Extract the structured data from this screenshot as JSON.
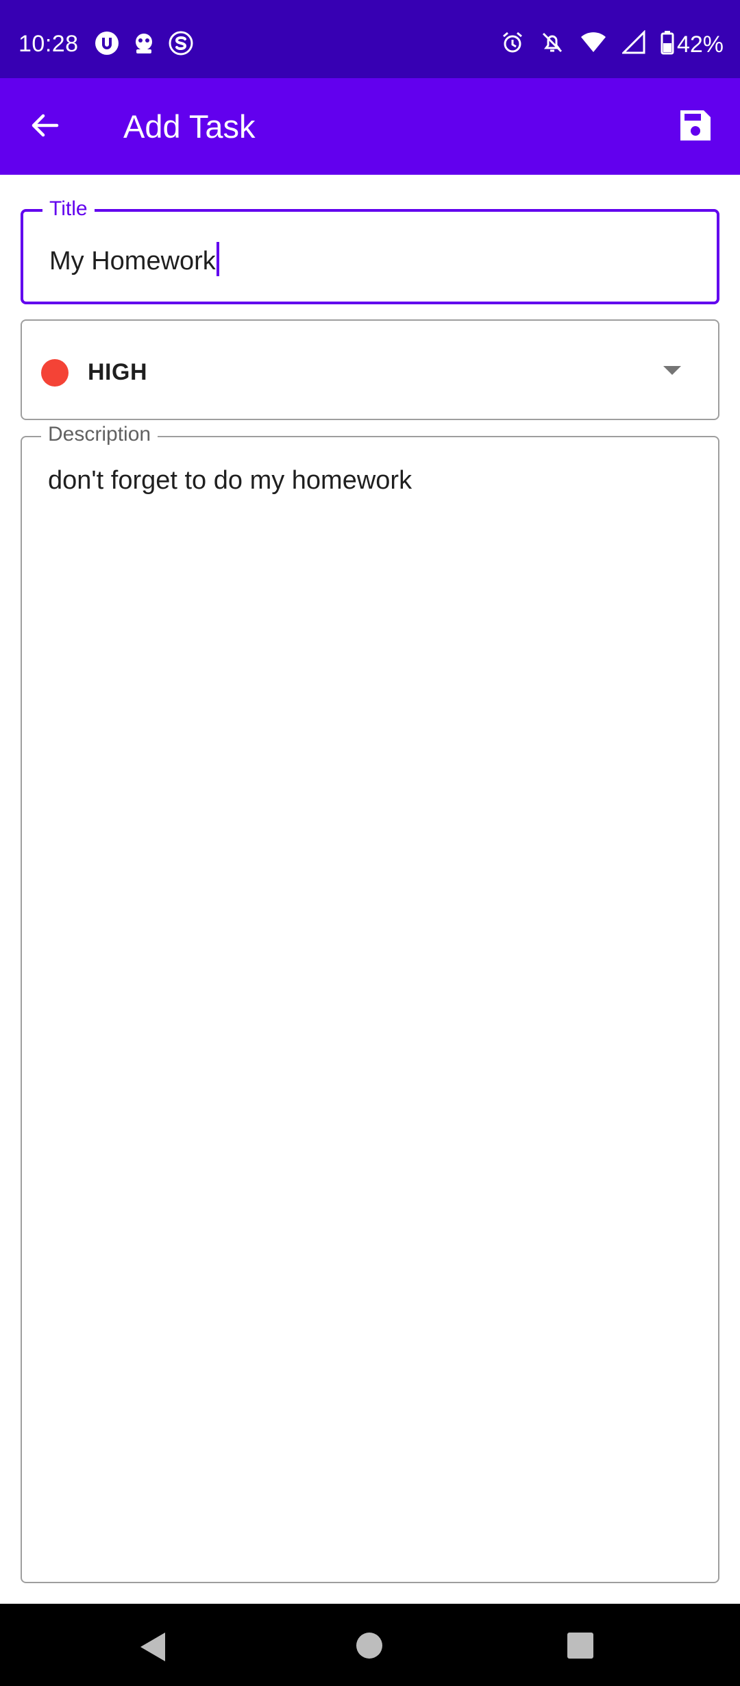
{
  "status_bar": {
    "time": "10:28",
    "battery": "42%",
    "left_icons": [
      "shield-badge-icon",
      "robot-icon",
      "s-logo-icon"
    ],
    "right_icons": [
      "alarm-icon",
      "notifications-off-icon",
      "wifi-icon",
      "signal-icon",
      "battery-icon"
    ],
    "background": "#3700b3"
  },
  "app_bar": {
    "title": "Add Task",
    "back_icon": "arrow-back-icon",
    "save_icon": "save-icon",
    "background": "#6200ee"
  },
  "form": {
    "title_field": {
      "label": "Title",
      "value": "My Homework",
      "accent": "#6200ee"
    },
    "priority": {
      "value": "HIGH",
      "dot_color": "#f44336"
    },
    "description_field": {
      "label": "Description",
      "value": "don't forget to do my homework"
    }
  },
  "nav_bar": {
    "icons": [
      "nav-back-icon",
      "nav-home-icon",
      "nav-recents-icon"
    ]
  }
}
